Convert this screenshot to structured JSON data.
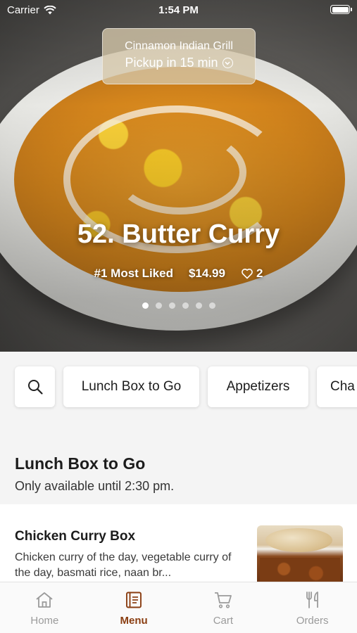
{
  "status_bar": {
    "carrier": "Carrier",
    "time": "1:54 PM"
  },
  "pickup": {
    "restaurant": "Cinnamon Indian Grill",
    "time": "Pickup in 15 min"
  },
  "featured": {
    "title": "52. Butter Curry",
    "badge": "#1 Most Liked",
    "price": "$14.99",
    "likes": "2",
    "slides": 6,
    "active_slide": 1
  },
  "categories": {
    "search_icon": "search-icon",
    "items": [
      "Lunch Box to Go",
      "Appetizers",
      "Cha"
    ]
  },
  "section": {
    "title": "Lunch Box to Go",
    "subtitle": "Only available until 2:30 pm."
  },
  "menu_item": {
    "name": "Chicken Curry Box",
    "description": "Chicken curry of the day, vegetable curry of the day, basmati rice, naan br..."
  },
  "tabs": [
    {
      "label": "Home",
      "icon": "home-icon",
      "active": false
    },
    {
      "label": "Menu",
      "icon": "menu-book-icon",
      "active": true
    },
    {
      "label": "Cart",
      "icon": "cart-icon",
      "active": false
    },
    {
      "label": "Orders",
      "icon": "fork-knife-icon",
      "active": false
    }
  ],
  "colors": {
    "accent": "#8a3e12",
    "tab_inactive": "#9b9b9b"
  }
}
